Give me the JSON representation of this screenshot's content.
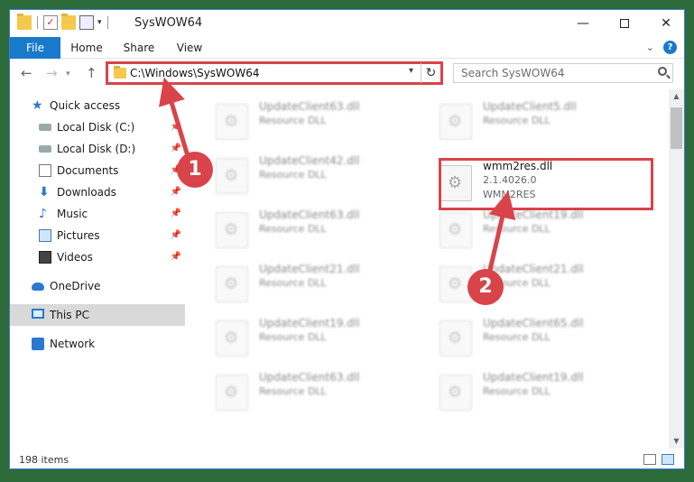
{
  "window": {
    "title": "SysWOW64",
    "controls": {
      "minimize": "—",
      "maximize": "",
      "close": "✕"
    }
  },
  "ribbon": {
    "tabs": [
      "File",
      "Home",
      "Share",
      "View"
    ]
  },
  "navbar": {
    "back": "←",
    "forward": "→",
    "up": "↑",
    "address": "C:\\Windows\\SysWOW64",
    "refresh": "↻",
    "search_placeholder": "Search SysWOW64"
  },
  "sidebar": {
    "items": [
      {
        "label": "Quick access",
        "icon": "star-icon",
        "pinned": false
      },
      {
        "label": "Local Disk (C:)",
        "icon": "disk-icon",
        "pinned": true
      },
      {
        "label": "Local Disk (D:)",
        "icon": "disk-icon",
        "pinned": true
      },
      {
        "label": "Documents",
        "icon": "documents-icon",
        "pinned": true
      },
      {
        "label": "Downloads",
        "icon": "downloads-icon",
        "pinned": true
      },
      {
        "label": "Music",
        "icon": "music-icon",
        "pinned": true
      },
      {
        "label": "Pictures",
        "icon": "pictures-icon",
        "pinned": true
      },
      {
        "label": "Videos",
        "icon": "videos-icon",
        "pinned": true
      },
      {
        "label": "OneDrive",
        "icon": "onedrive-icon",
        "pinned": false
      },
      {
        "label": "This PC",
        "icon": "this-pc-icon",
        "pinned": false,
        "selected": true
      },
      {
        "label": "Network",
        "icon": "network-icon",
        "pinned": false
      }
    ]
  },
  "files": {
    "left_column": [
      {
        "name": "UpdateClient63.dll",
        "type": "Resource DLL"
      },
      {
        "name": "UpdateClient42.dll",
        "type": "Resource DLL"
      },
      {
        "name": "UpdateClient63.dll",
        "type": "Resource DLL"
      },
      {
        "name": "UpdateClient21.dll",
        "type": "Resource DLL"
      },
      {
        "name": "UpdateClient19.dll",
        "type": "Resource DLL"
      },
      {
        "name": "UpdateClient63.dll",
        "type": "Resource DLL"
      }
    ],
    "right_column": [
      {
        "name": "UpdateClient5.dll",
        "type": "Resource DLL"
      },
      {
        "name": "wmm2res.dll",
        "version": "2.1.4026.0",
        "type": "WMM2RES"
      },
      {
        "name": "UpdateClient19.dll",
        "type": "Resource DLL"
      },
      {
        "name": "UpdateClient21.dll",
        "type": "Resource DLL"
      },
      {
        "name": "UpdateClient65.dll",
        "type": "Resource DLL"
      },
      {
        "name": "UpdateClient19.dll",
        "type": "Resource DLL"
      }
    ]
  },
  "status": {
    "item_count": "198 items"
  },
  "annotations": {
    "step1": "1",
    "step2": "2",
    "accent": "#d9434a"
  }
}
